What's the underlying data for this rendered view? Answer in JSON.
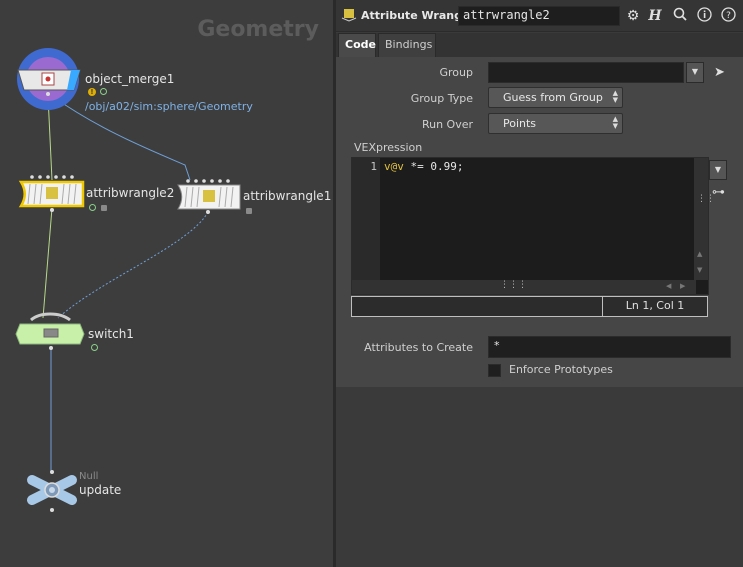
{
  "network": {
    "context_label": "Geometry",
    "nodes": {
      "object_merge": {
        "name": "object_merge1",
        "path": "/obj/a02/sim:sphere/Geometry"
      },
      "attribwrangle2": {
        "name": "attribwrangle2"
      },
      "attribwrangle1": {
        "name": "attribwrangle1"
      },
      "switch": {
        "name": "switch1"
      },
      "update": {
        "type": "Null",
        "name": "update"
      }
    }
  },
  "params": {
    "header": {
      "op_type": "Attribute Wrangle",
      "op_name": "attrwrangle2",
      "help_icon": "H"
    },
    "tabs": [
      {
        "label": "Code"
      },
      {
        "label": "Bindings"
      }
    ],
    "fields": {
      "group_label": "Group",
      "group_value": "",
      "group_type_label": "Group Type",
      "group_type_value": "Guess from Group",
      "run_over_label": "Run Over",
      "run_over_value": "Points",
      "vexpression_label": "VEXpression",
      "code_line_number": "1",
      "code_line_attr": "v@v",
      "code_line_rest": " *= 0.99;",
      "cursor_position": "Ln 1, Col 1",
      "attributes_to_create_label": "Attributes to Create",
      "attributes_to_create_value": "*",
      "enforce_prototypes_label": "Enforce Prototypes",
      "enforce_prototypes_checked": false
    }
  }
}
